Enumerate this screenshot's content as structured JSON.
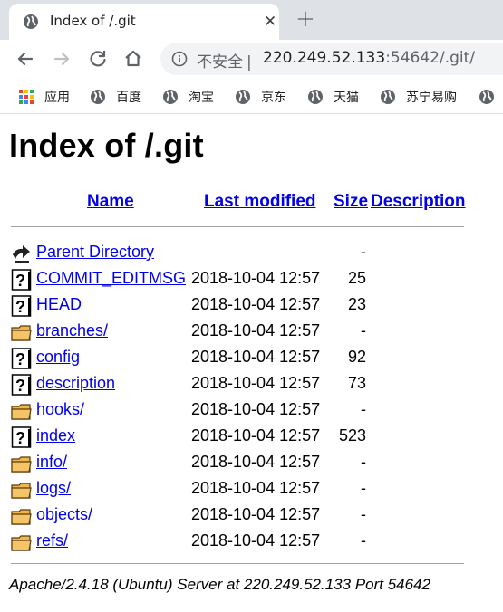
{
  "tab": {
    "title": "Index of /.git",
    "close_glyph": "✕",
    "new_tab_glyph": "+"
  },
  "omnibox": {
    "security_label": "不安全",
    "separator": "|",
    "url_host": "220.249.52.133",
    "url_port": ":54642",
    "url_path": "/.git/"
  },
  "bookmarks": [
    {
      "label": "应用",
      "icon": "apps-grid-icon"
    },
    {
      "label": "百度",
      "icon": "globe-icon"
    },
    {
      "label": "淘宝",
      "icon": "globe-icon"
    },
    {
      "label": "京东",
      "icon": "globe-icon"
    },
    {
      "label": "天猫",
      "icon": "globe-icon"
    },
    {
      "label": "苏宁易购",
      "icon": "globe-icon"
    }
  ],
  "page": {
    "title": "Index of /.git",
    "columns": {
      "name": "Name",
      "last_modified": "Last modified",
      "size": "Size",
      "description": "Description"
    },
    "rows": [
      {
        "name": "Parent Directory",
        "modified": "",
        "size": "-",
        "icon": "back-arrow-icon"
      },
      {
        "name": "COMMIT_EDITMSG",
        "modified": "2018-10-04 12:57",
        "size": "25",
        "icon": "unknown-file-icon"
      },
      {
        "name": "HEAD",
        "modified": "2018-10-04 12:57",
        "size": "23",
        "icon": "unknown-file-icon"
      },
      {
        "name": "branches/",
        "modified": "2018-10-04 12:57",
        "size": "-",
        "icon": "folder-icon"
      },
      {
        "name": "config",
        "modified": "2018-10-04 12:57",
        "size": "92",
        "icon": "unknown-file-icon"
      },
      {
        "name": "description",
        "modified": "2018-10-04 12:57",
        "size": "73",
        "icon": "unknown-file-icon"
      },
      {
        "name": "hooks/",
        "modified": "2018-10-04 12:57",
        "size": "-",
        "icon": "folder-icon"
      },
      {
        "name": "index",
        "modified": "2018-10-04 12:57",
        "size": "523",
        "icon": "unknown-file-icon"
      },
      {
        "name": "info/",
        "modified": "2018-10-04 12:57",
        "size": "-",
        "icon": "folder-icon"
      },
      {
        "name": "logs/",
        "modified": "2018-10-04 12:57",
        "size": "-",
        "icon": "folder-icon"
      },
      {
        "name": "objects/",
        "modified": "2018-10-04 12:57",
        "size": "-",
        "icon": "folder-icon"
      },
      {
        "name": "refs/",
        "modified": "2018-10-04 12:57",
        "size": "-",
        "icon": "folder-icon"
      }
    ],
    "footer": "Apache/2.4.18 (Ubuntu) Server at 220.249.52.133 Port 54642"
  }
}
